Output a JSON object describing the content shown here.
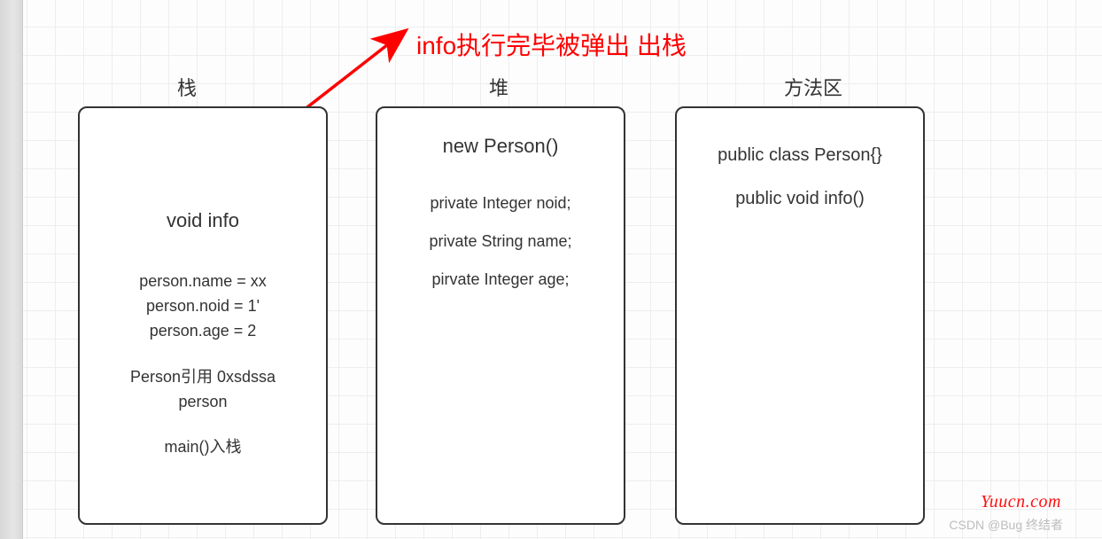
{
  "title": "info执行完毕被弹出 出栈",
  "columns": {
    "stack": {
      "label": "栈"
    },
    "heap": {
      "label": "堆"
    },
    "method": {
      "label": "方法区"
    }
  },
  "stack_panel": {
    "big1": "void info",
    "l1": "person.name = xx",
    "l2": "person.noid = 1'",
    "l3": "person.age = 2",
    "l4": "Person引用 0xsdssa",
    "l5": "person",
    "l6": "main()入栈"
  },
  "heap_panel": {
    "big1": "new Person()",
    "l1": "private Integer noid;",
    "l2": "private String name;",
    "l3": "pirvate Integer age;"
  },
  "method_panel": {
    "l1": "public class Person{}",
    "l2": "public void info()"
  },
  "watermark": {
    "right": "Yuucn.com",
    "bottom": "CSDN @Bug 终结者"
  }
}
